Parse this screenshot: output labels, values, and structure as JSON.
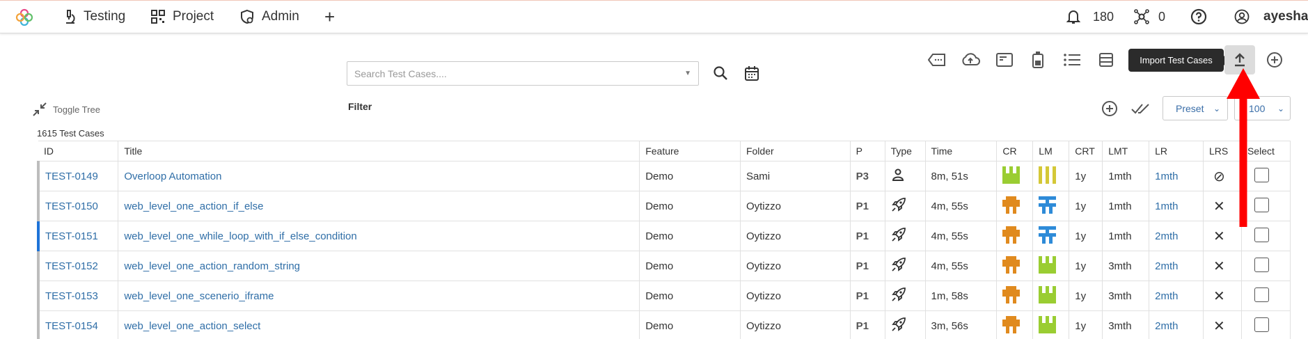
{
  "nav": {
    "testing": "Testing",
    "project": "Project",
    "admin": "Admin",
    "add": "+",
    "notifications": "180",
    "network": "0",
    "user": "ayesha"
  },
  "search": {
    "placeholder": "Search Test Cases...."
  },
  "toolbar": {
    "tooltip": "Import Test Cases",
    "preset": "Preset",
    "page_size": "100"
  },
  "toggle_tree": "Toggle Tree",
  "filter": "Filter",
  "count": "1615 Test Cases",
  "columns": [
    "ID",
    "Title",
    "Feature",
    "Folder",
    "P",
    "Type",
    "Time",
    "CR",
    "LM",
    "CRT",
    "LMT",
    "LR",
    "LRS",
    "Select"
  ],
  "rows": [
    {
      "id": "TEST-0149",
      "title": "Overloop Automation",
      "feature": "Demo",
      "folder": "Sami",
      "p": "P3",
      "type": "person-icon",
      "time": "8m, 51s",
      "cr": "green",
      "lm": "yellow",
      "crt": "1y",
      "lmt": "1mth",
      "lr": "1mth",
      "lrs": "⊘"
    },
    {
      "id": "TEST-0150",
      "title": "web_level_one_action_if_else",
      "feature": "Demo",
      "folder": "Oytizzo",
      "p": "P1",
      "type": "rocket-icon",
      "time": "4m, 55s",
      "cr": "orange",
      "lm": "blue",
      "crt": "1y",
      "lmt": "1mth",
      "lr": "1mth",
      "lrs": "✕"
    },
    {
      "id": "TEST-0151",
      "title": "web_level_one_while_loop_with_if_else_condition",
      "feature": "Demo",
      "folder": "Oytizzo",
      "p": "P1",
      "type": "rocket-icon",
      "time": "4m, 55s",
      "cr": "orange",
      "lm": "blue",
      "crt": "1y",
      "lmt": "1mth",
      "lr": "2mth",
      "lrs": "✕"
    },
    {
      "id": "TEST-0152",
      "title": "web_level_one_action_random_string",
      "feature": "Demo",
      "folder": "Oytizzo",
      "p": "P1",
      "type": "rocket-icon",
      "time": "4m, 55s",
      "cr": "orange",
      "lm": "green",
      "crt": "1y",
      "lmt": "3mth",
      "lr": "2mth",
      "lrs": "✕"
    },
    {
      "id": "TEST-0153",
      "title": "web_level_one_scenerio_iframe",
      "feature": "Demo",
      "folder": "Oytizzo",
      "p": "P1",
      "type": "rocket-icon",
      "time": "1m, 58s",
      "cr": "orange",
      "lm": "green",
      "crt": "1y",
      "lmt": "3mth",
      "lr": "2mth",
      "lrs": "✕"
    },
    {
      "id": "TEST-0154",
      "title": "web_level_one_action_select",
      "feature": "Demo",
      "folder": "Oytizzo",
      "p": "P1",
      "type": "rocket-icon",
      "time": "3m, 56s",
      "cr": "orange",
      "lm": "green",
      "crt": "1y",
      "lmt": "3mth",
      "lr": "2mth",
      "lrs": "✕"
    }
  ],
  "colors": {
    "accent_link": "#2f6ea7",
    "active_row": "#1e73d8",
    "arrow": "#ff0000",
    "green": "#9acd32",
    "yellow": "#d4c837",
    "orange": "#e08a1e",
    "blue": "#2e8bd8"
  }
}
